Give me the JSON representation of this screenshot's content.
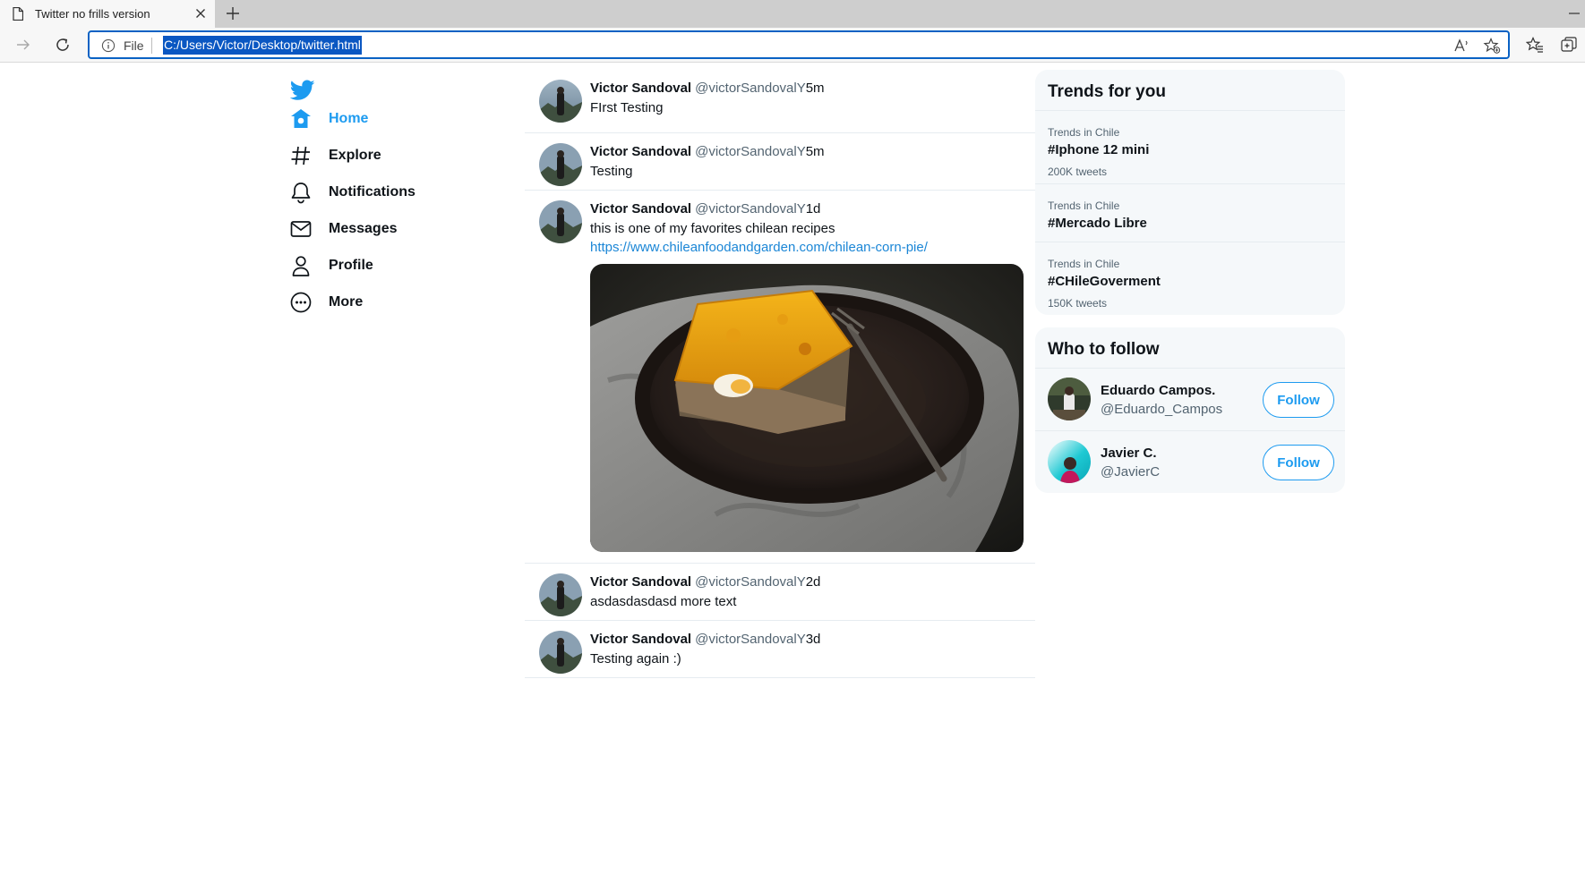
{
  "browser": {
    "tab_title": "Twitter no frills version",
    "address_prefix": "File",
    "address_url": "C:/Users/Victor/Desktop/twitter.html"
  },
  "sidebar": {
    "accent_color": "#1d9bf0",
    "items": [
      {
        "label": "Home",
        "icon": "home-icon",
        "active": true
      },
      {
        "label": "Explore",
        "icon": "hashtag-icon"
      },
      {
        "label": "Notifications",
        "icon": "bell-icon"
      },
      {
        "label": "Messages",
        "icon": "envelope-icon"
      },
      {
        "label": "Profile",
        "icon": "person-icon"
      },
      {
        "label": "More",
        "icon": "more-icon"
      }
    ]
  },
  "feed": {
    "tweets": [
      {
        "name": "Victor Sandoval",
        "handle": "@victorSandovalY",
        "time": "5m",
        "text": "FIrst Testing"
      },
      {
        "name": "Victor Sandoval",
        "handle": "@victorSandovalY",
        "time": "5m",
        "text": "Testing"
      },
      {
        "name": "Victor Sandoval",
        "handle": "@victorSandovalY",
        "time": "1d",
        "text": "this is one of my favorites chilean recipes",
        "link": "https://www.chileanfoodandgarden.com/chilean-corn-pie/",
        "has_media": true
      },
      {
        "name": "Victor Sandoval",
        "handle": "@victorSandovalY",
        "time": "2d",
        "text": "asdasdasdasd more text"
      },
      {
        "name": "Victor Sandoval",
        "handle": "@victorSandovalY",
        "time": "3d",
        "text": "Testing again :)"
      }
    ]
  },
  "trends": {
    "title": "Trends for you",
    "items": [
      {
        "context": "Trends in Chile",
        "tag": "#Iphone 12 mini",
        "count": "200K tweets"
      },
      {
        "context": "Trends in Chile",
        "tag": "#Mercado Libre",
        "count": ""
      },
      {
        "context": "Trends in Chile",
        "tag": "#CHileGoverment",
        "count": "150K tweets"
      }
    ]
  },
  "who_to_follow": {
    "title": "Who to follow",
    "users": [
      {
        "name": "Eduardo Campos.",
        "handle": "@Eduardo_Campos",
        "button": "Follow"
      },
      {
        "name": "Javier C.",
        "handle": "@JavierC",
        "button": "Follow"
      }
    ]
  }
}
